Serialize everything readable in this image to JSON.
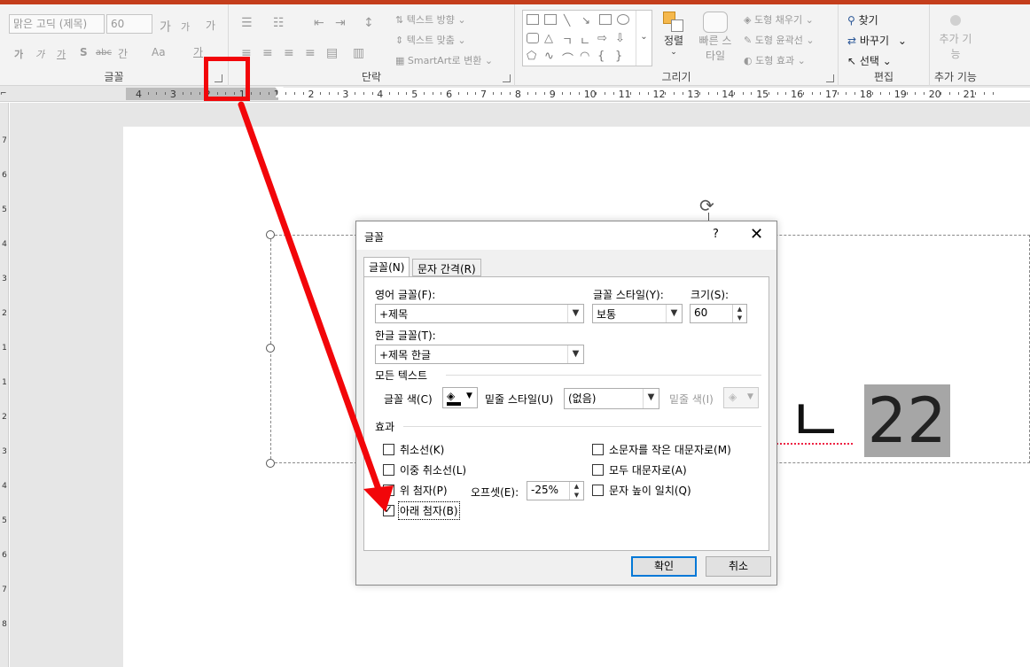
{
  "ribbon": {
    "font_group": {
      "label": "글꼴",
      "font_name": "맑은 고딕 (제목)",
      "font_size": "60",
      "grow_icon": "가",
      "shrink_icon": "가",
      "clear_format_icon": "가",
      "bold": "가",
      "italic": "가",
      "underline": "가",
      "shadow": "S",
      "strike": "abc",
      "spacing": "간",
      "case": "Aa",
      "color": "가"
    },
    "paragraph_group": {
      "label": "단락",
      "text_direction": "텍스트 방향",
      "align_text": "텍스트 맞춤",
      "smartart": "SmartArt로 변환"
    },
    "drawing_group": {
      "label": "그리기",
      "arrange": "정렬",
      "quick_styles": "빠른 스타일",
      "shape_fill": "도형 채우기",
      "shape_outline": "도형 윤곽선",
      "shape_effects": "도형 효과"
    },
    "editing_group": {
      "label": "편집",
      "find": "찾기",
      "replace": "바꾸기",
      "select": "선택"
    },
    "addins_group": {
      "label": "추가 기능",
      "addins_button": "추가 기능"
    }
  },
  "ruler": {
    "h_numbers": [
      "4",
      "3",
      "2",
      "1",
      "1",
      "2",
      "3",
      "4",
      "5",
      "6",
      "7",
      "8",
      "9",
      "10",
      "11",
      "12",
      "13",
      "14",
      "15",
      "16",
      "17",
      "18",
      "19",
      "20",
      "21"
    ],
    "v_numbers": [
      "7",
      "6",
      "5",
      "4",
      "3",
      "2",
      "1",
      "1",
      "2",
      "3",
      "4",
      "5",
      "6",
      "7",
      "8"
    ]
  },
  "slide": {
    "text_prefix": "ㄴ",
    "text_selected": "22"
  },
  "dialog": {
    "title": "글꼴",
    "help": "?",
    "close": "✕",
    "tabs": [
      "글꼴(N)",
      "문자 간격(R)"
    ],
    "latin_font_label": "영어 글꼴(F):",
    "latin_font_value": "+제목",
    "style_label": "글꼴 스타일(Y):",
    "style_value": "보통",
    "size_label": "크기(S):",
    "size_value": "60",
    "asian_font_label": "한글 글꼴(T):",
    "asian_font_value": "+제목 한글",
    "all_text_section": "모든 텍스트",
    "font_color_label": "글꼴 색(C)",
    "underline_style_label": "밑줄 스타일(U)",
    "underline_style_value": "(없음)",
    "underline_color_label": "밑줄 색(I)",
    "effects_section": "효과",
    "effects": {
      "strikethrough": "취소선(K)",
      "double_strikethrough": "이중 취소선(L)",
      "superscript": "위 첨자(P)",
      "subscript": "아래 첨자(B)",
      "small_caps": "소문자를 작은 대문자로(M)",
      "all_caps": "모두 대문자로(A)",
      "equalize_height": "문자 높이 일치(Q)"
    },
    "offset_label": "오프셋(E):",
    "offset_value": "-25%",
    "ok": "확인",
    "cancel": "취소"
  },
  "colors": {
    "accent": "#c43e1c",
    "annotation": "#f2060a",
    "selection": "#a6a6a6"
  }
}
